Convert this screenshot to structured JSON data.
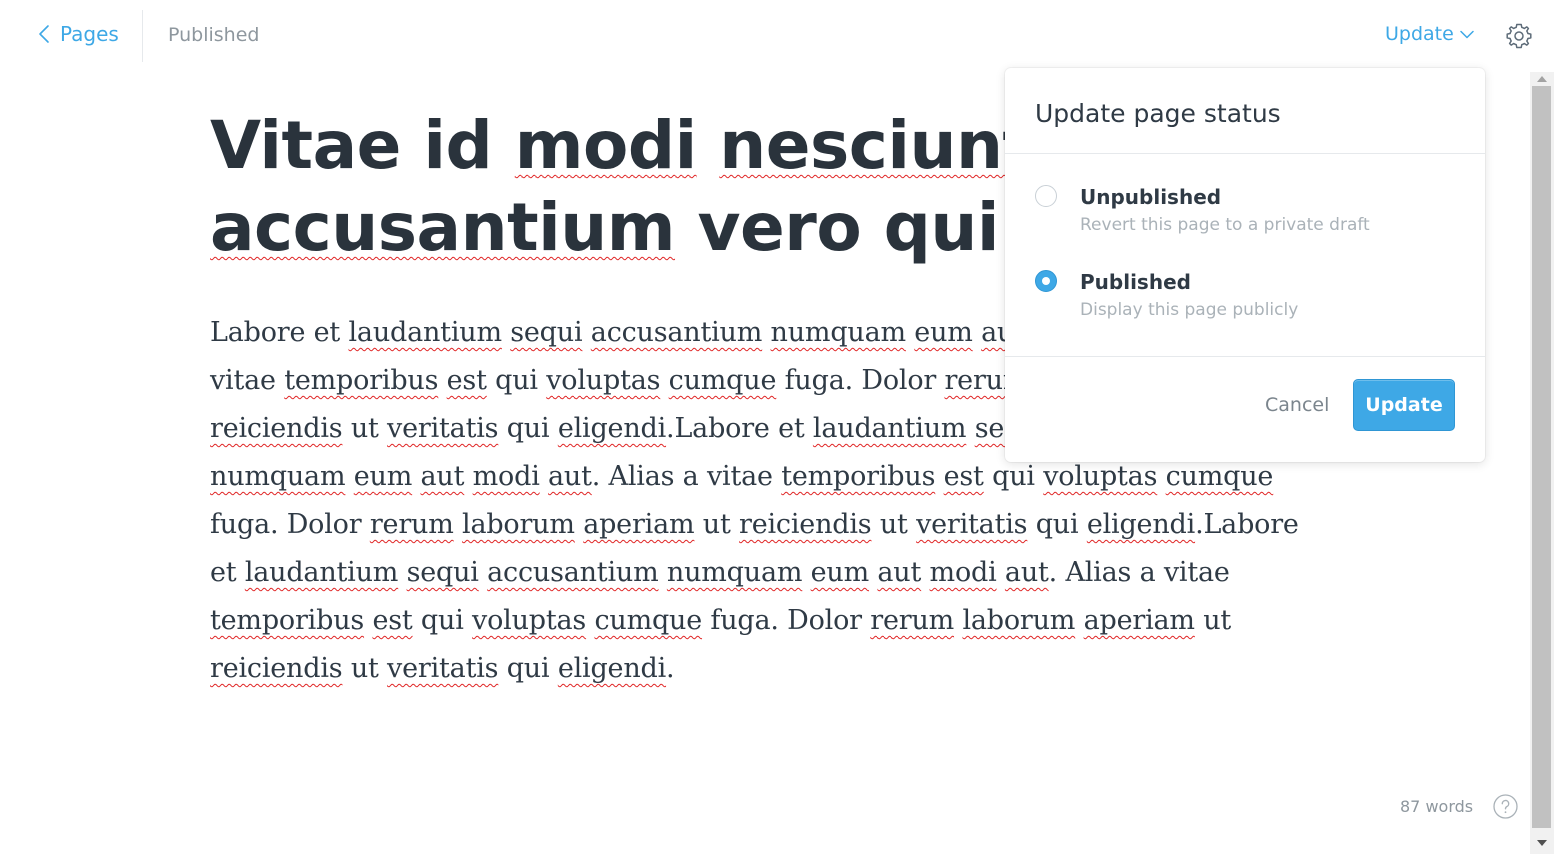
{
  "topbar": {
    "back_label": "Pages",
    "status": "Published",
    "update_label": "Update"
  },
  "editor": {
    "title_line1": "Vitae id modi nesciunt",
    "title_line2": "accusantium vero qui eius",
    "body_text": "Labore et laudantium sequi accusantium numquam eum aut modi aut. Alias a vitae temporibus est qui voluptas cumque fuga. Dolor rerum laborum aperiam ut reiciendis ut veritatis qui eligendi.Labore et laudantium sequi accusantium numquam eum aut modi aut. Alias a vitae temporibus est qui voluptas cumque fuga. Dolor rerum laborum aperiam ut reiciendis ut veritatis qui eligendi.Labore et laudantium sequi accusantium numquam eum aut modi aut. Alias a vitae temporibus est qui voluptas cumque fuga. Dolor rerum laborum aperiam ut reiciendis ut veritatis qui eligendi."
  },
  "footer": {
    "word_count": "87 words"
  },
  "popover": {
    "title": "Update page status",
    "options": [
      {
        "label": "Unpublished",
        "description": "Revert this page to a private draft",
        "selected": false
      },
      {
        "label": "Published",
        "description": "Display this page publicly",
        "selected": true
      }
    ],
    "cancel_label": "Cancel",
    "update_label": "Update"
  },
  "colors": {
    "accent": "#3ea8e6",
    "text": "#2f3a45",
    "muted": "#8e979e",
    "spellcheck": "#e02424"
  },
  "icons": {
    "back": "chevron-left-icon",
    "dropdown": "chevron-down-icon",
    "settings": "gear-icon",
    "help": "help-icon"
  }
}
